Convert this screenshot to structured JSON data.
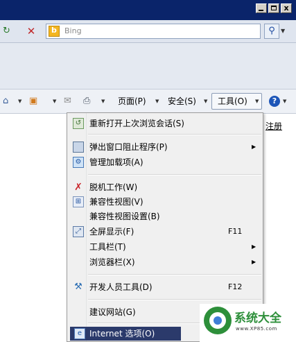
{
  "window": {
    "buttons": {
      "minimize": "",
      "maximize": "",
      "close": "x"
    }
  },
  "search": {
    "placeholder": "Bing",
    "button_icon": "search-icon"
  },
  "commandbar": {
    "page_label": "页面(P)",
    "safety_label": "安全(S)",
    "tools_label": "工具(O)",
    "help_icon": "help-icon"
  },
  "page": {
    "link_text": "注册"
  },
  "tools_menu": {
    "items": [
      {
        "label": "重新打开上次浏览会话(S)",
        "icon": "reopen-session-icon"
      },
      {
        "label": "弹出窗口阻止程序(P)",
        "icon": "popup-blocker-icon",
        "submenu": true
      },
      {
        "label": "管理加载项(A)",
        "icon": "manage-addons-icon"
      },
      {
        "label": "脱机工作(W)",
        "icon": "work-offline-icon"
      },
      {
        "label": "兼容性视图(V)",
        "icon": "compat-view-icon"
      },
      {
        "label": "兼容性视图设置(B)"
      },
      {
        "label": "全屏显示(F)",
        "icon": "fullscreen-icon",
        "shortcut": "F11"
      },
      {
        "label": "工具栏(T)",
        "submenu": true
      },
      {
        "label": "浏览器栏(X)",
        "submenu": true
      },
      {
        "label": "开发人员工具(D)",
        "icon": "developer-tools-icon",
        "shortcut": "F12"
      },
      {
        "label": "建议网站(G)"
      },
      {
        "label": "Internet 选项(O)",
        "icon": "internet-options-icon",
        "highlighted": true
      }
    ],
    "highlight_color": "#2b3a6b"
  },
  "watermark": {
    "title": "系统大全",
    "url": "www.XP85.com"
  }
}
